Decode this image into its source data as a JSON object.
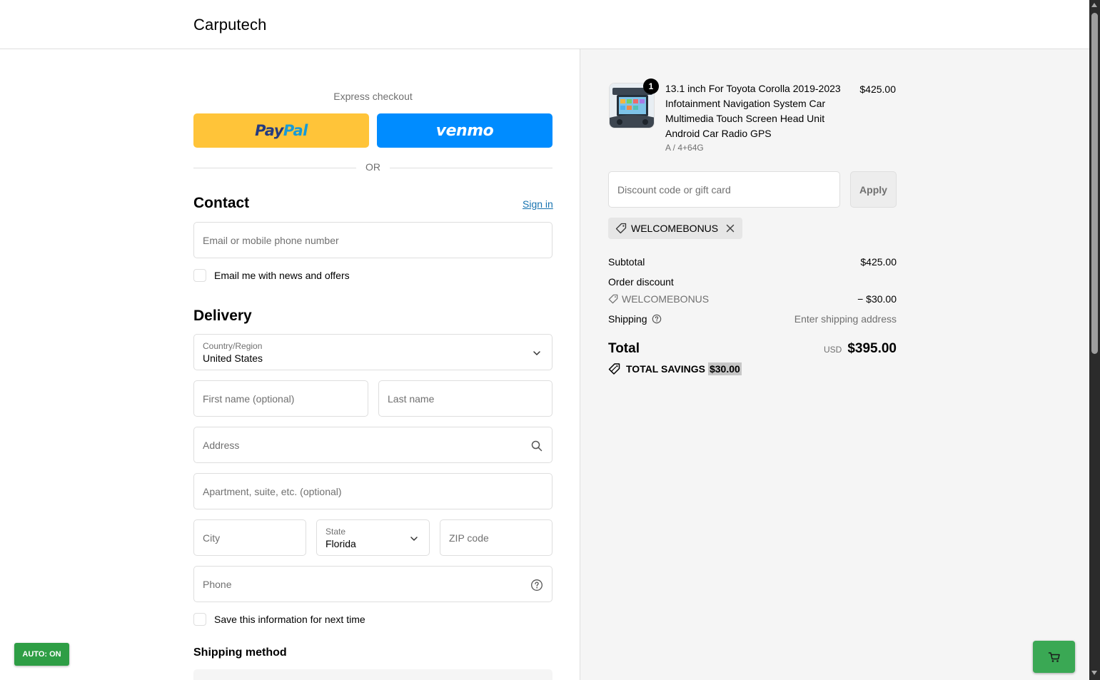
{
  "header": {
    "brand": "Carputech"
  },
  "express": {
    "title": "Express checkout",
    "paypal_a": "Pay",
    "paypal_b": "Pal",
    "venmo": "venmo",
    "or": "OR"
  },
  "contact": {
    "heading": "Contact",
    "sign_in": "Sign in",
    "email_placeholder": "Email or mobile phone number",
    "news_label": "Email me with news and offers"
  },
  "delivery": {
    "heading": "Delivery",
    "country_label": "Country/Region",
    "country_value": "United States",
    "first_name_placeholder": "First name (optional)",
    "last_name_placeholder": "Last name",
    "address_placeholder": "Address",
    "apartment_placeholder": "Apartment, suite, etc. (optional)",
    "city_placeholder": "City",
    "state_label": "State",
    "state_value": "Florida",
    "zip_placeholder": "ZIP code",
    "phone_placeholder": "Phone",
    "save_label": "Save this information for next time"
  },
  "shipping_method": {
    "heading": "Shipping method"
  },
  "order": {
    "product_title": "13.1 inch For Toyota Corolla 2019-2023 Infotainment Navigation System Car Multimedia Touch Screen Head Unit Android Car Radio GPS",
    "product_variant": "A / 4+64G",
    "product_price": "$425.00",
    "quantity": "1",
    "discount_placeholder": "Discount code or gift card",
    "apply_label": "Apply",
    "applied_code": "WELCOMEBONUS",
    "subtotal_label": "Subtotal",
    "subtotal_value": "$425.00",
    "order_discount_label": "Order discount",
    "discount_code": "WELCOMEBONUS",
    "discount_value": "− $30.00",
    "shipping_label": "Shipping",
    "shipping_value": "Enter shipping address",
    "total_label": "Total",
    "currency": "USD",
    "total_value": "$395.00",
    "savings_label": "TOTAL SAVINGS",
    "savings_value": "$30.00"
  },
  "widgets": {
    "auto_label": "AUTO: ON"
  },
  "colors": {
    "paypal_bg": "#ffc439",
    "venmo_bg": "#008cff",
    "link": "#1773b0",
    "widget_green": "#2e9e45"
  }
}
